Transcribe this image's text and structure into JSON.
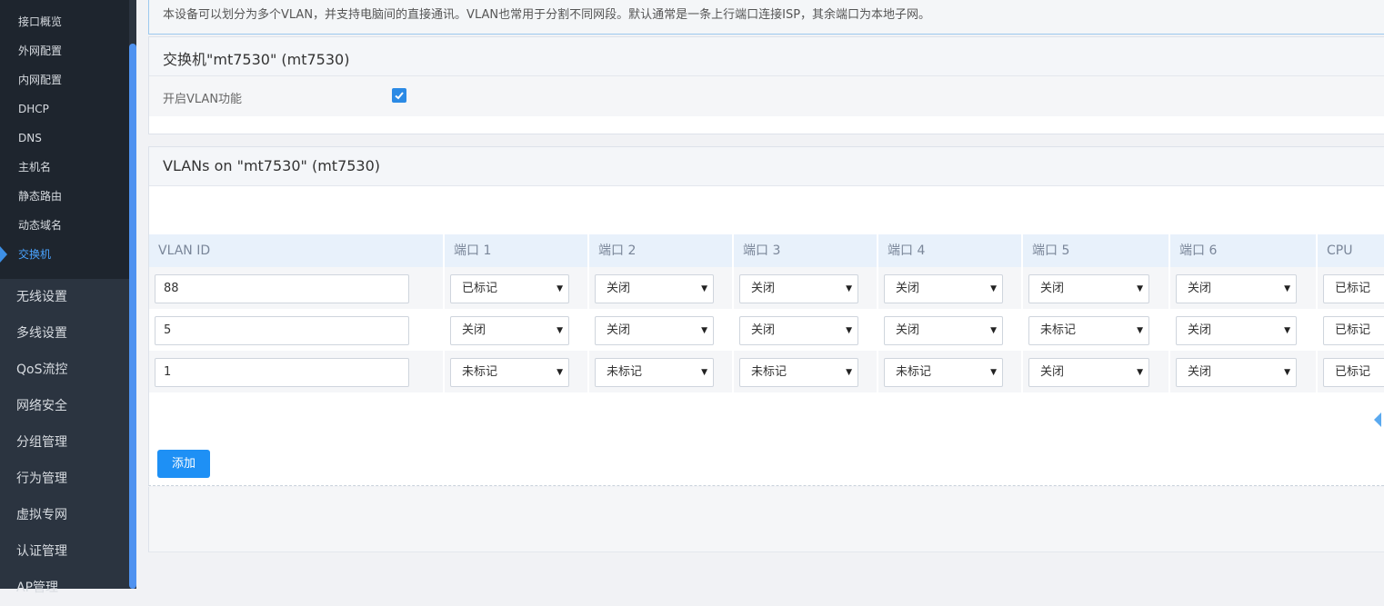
{
  "sidebar": {
    "sub_items": [
      {
        "label": "接口概览"
      },
      {
        "label": "外网配置"
      },
      {
        "label": "内网配置"
      },
      {
        "label": "DHCP"
      },
      {
        "label": "DNS"
      },
      {
        "label": "主机名"
      },
      {
        "label": "静态路由"
      },
      {
        "label": "动态域名"
      },
      {
        "label": "交换机",
        "active": true
      }
    ],
    "main_items": [
      {
        "label": "无线设置"
      },
      {
        "label": "多线设置"
      },
      {
        "label": "QoS流控"
      },
      {
        "label": "网络安全"
      },
      {
        "label": "分组管理"
      },
      {
        "label": "行为管理"
      },
      {
        "label": "虚拟专网"
      },
      {
        "label": "认证管理"
      },
      {
        "label": "AP管理"
      }
    ]
  },
  "info": {
    "text": "本设备可以划分为多个VLAN，并支持电脑间的直接通讯。VLAN也常用于分割不同网段。默认通常是一条上行端口连接ISP，其余端口为本地子网。"
  },
  "switch_panel": {
    "title": "交换机\"mt7530\" (mt7530)",
    "vlan_label": "开启VLAN功能",
    "vlan_enabled": true
  },
  "vlans_panel": {
    "title": "VLANs on \"mt7530\" (mt7530)",
    "columns": [
      "VLAN ID",
      "端口 1",
      "端口 2",
      "端口 3",
      "端口 4",
      "端口 5",
      "端口 6",
      "CPU"
    ],
    "rows": [
      {
        "vlan_id": "88",
        "ports": [
          "已标记",
          "关闭",
          "关闭",
          "关闭",
          "关闭",
          "关闭",
          "已标记"
        ]
      },
      {
        "vlan_id": "5",
        "ports": [
          "关闭",
          "关闭",
          "关闭",
          "关闭",
          "未标记",
          "关闭",
          "已标记"
        ]
      },
      {
        "vlan_id": "1",
        "ports": [
          "未标记",
          "未标记",
          "未标记",
          "未标记",
          "关闭",
          "关闭",
          "已标记"
        ]
      }
    ],
    "add_label": "添加"
  },
  "colors": {
    "accent": "#1e90f5",
    "sidebar_bg": "#2b3440",
    "active_text": "#4aa3ff"
  }
}
